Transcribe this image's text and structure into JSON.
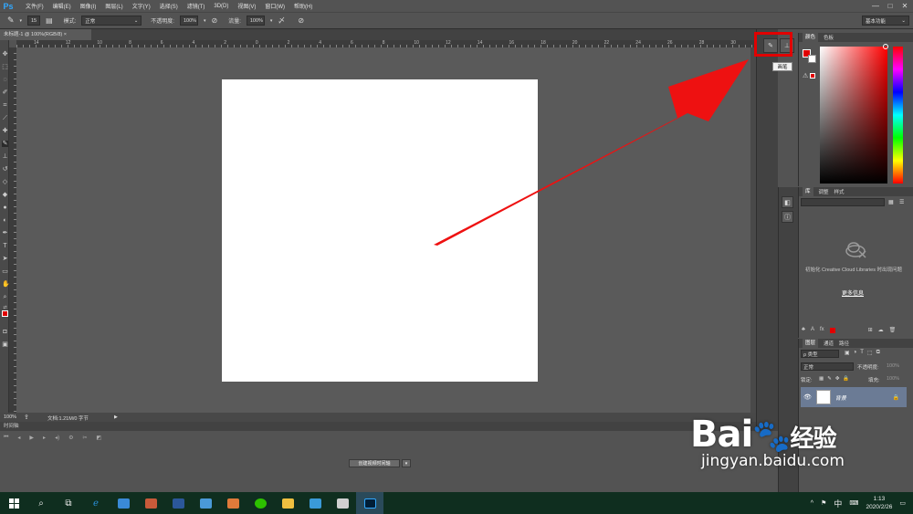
{
  "app": {
    "logo": "Ps",
    "menu": [
      "文件(F)",
      "编辑(E)",
      "图像(I)",
      "图层(L)",
      "文字(Y)",
      "选择(S)",
      "滤镜(T)",
      "3D(D)",
      "视图(V)",
      "窗口(W)",
      "帮助(H)"
    ],
    "window_controls": [
      "—",
      "□",
      "✕"
    ]
  },
  "options_bar": {
    "brush_size": "15",
    "mode_label": "模式:",
    "mode_value": "正常",
    "opacity_label": "不透明度:",
    "opacity_value": "100%",
    "flow_label": "流量:",
    "flow_value": "100%",
    "workspace": "基本功能"
  },
  "document": {
    "tab_title": "未标题-1 @ 100%(RGB/8)",
    "zoom": "100%",
    "doc_info": "文档:1.21M/0 字节",
    "ruler_numbers": [
      "14",
      "12",
      "10",
      "8",
      "6",
      "4",
      "2",
      "0",
      "2",
      "4",
      "6",
      "8",
      "10",
      "12",
      "14",
      "16",
      "18",
      "20",
      "22",
      "24",
      "26",
      "28",
      "30"
    ]
  },
  "timeline": {
    "header": "时间轴",
    "create_button": "创建视频时间轴",
    "dropdown": "▾",
    "controls": [
      "⏮",
      "◂",
      "▶",
      "▸",
      "◂)",
      "⚙",
      "✂",
      "◩"
    ]
  },
  "dock": {
    "tooltip": "画笔",
    "highlight_color": "#e10000"
  },
  "color_panel": {
    "tabs": [
      "颜色",
      "色板"
    ],
    "foreground": "#e10000",
    "background": "#ffffff"
  },
  "libraries_panel": {
    "tabs": [
      "库",
      "调整",
      "样式"
    ],
    "message": "初始化 Creative Cloud Libraries 时出现问题",
    "more_info": "更多信息"
  },
  "layers_panel": {
    "tabs": [
      "图层",
      "通道",
      "路径"
    ],
    "filter_label": "ρ 类型",
    "blend_mode": "正常",
    "opacity_label": "不透明度:",
    "opacity_value": "100%",
    "lock_label": "锁定:",
    "fill_label": "填充:",
    "fill_value": "100%",
    "layer_name": "背景"
  },
  "taskbar": {
    "ime": "中",
    "time": "1:13",
    "date": "2020/2/26"
  },
  "watermark": {
    "logo_text": "Bai",
    "logo_suffix": "经验",
    "url": "jingyan.baidu.com"
  }
}
